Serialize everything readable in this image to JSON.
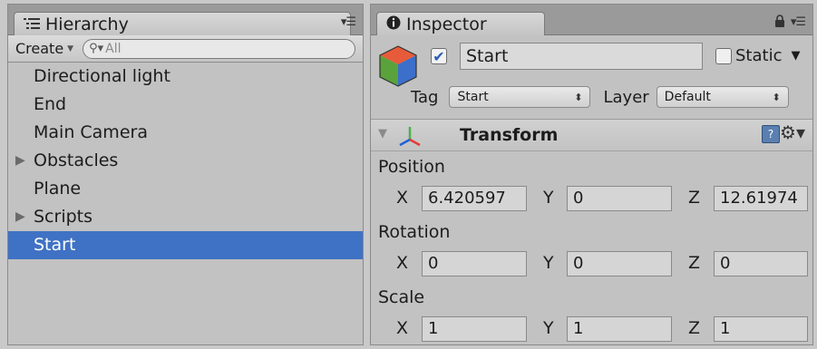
{
  "hierarchy": {
    "tab_label": "Hierarchy",
    "create_label": "Create",
    "search_placeholder": "All",
    "items": [
      {
        "label": "Directional light",
        "expandable": false
      },
      {
        "label": "End",
        "expandable": false
      },
      {
        "label": "Main Camera",
        "expandable": false
      },
      {
        "label": "Obstacles",
        "expandable": true
      },
      {
        "label": "Plane",
        "expandable": false
      },
      {
        "label": "Scripts",
        "expandable": true
      },
      {
        "label": "Start",
        "expandable": false,
        "selected": true
      }
    ]
  },
  "inspector": {
    "tab_label": "Inspector",
    "object_name": "Start",
    "active": true,
    "static_label": "Static",
    "static_checked": false,
    "tag_label": "Tag",
    "tag_value": "Start",
    "layer_label": "Layer",
    "layer_value": "Default",
    "transform": {
      "title": "Transform",
      "position_label": "Position",
      "rotation_label": "Rotation",
      "scale_label": "Scale",
      "axis_x": "X",
      "axis_y": "Y",
      "axis_z": "Z",
      "position": {
        "x": "6.420597",
        "y": "0",
        "z": "12.61974"
      },
      "rotation": {
        "x": "0",
        "y": "0",
        "z": "0"
      },
      "scale": {
        "x": "1",
        "y": "1",
        "z": "1"
      }
    }
  },
  "colors": {
    "selection": "#3f72c4",
    "panel_bg": "#c2c2c2"
  }
}
